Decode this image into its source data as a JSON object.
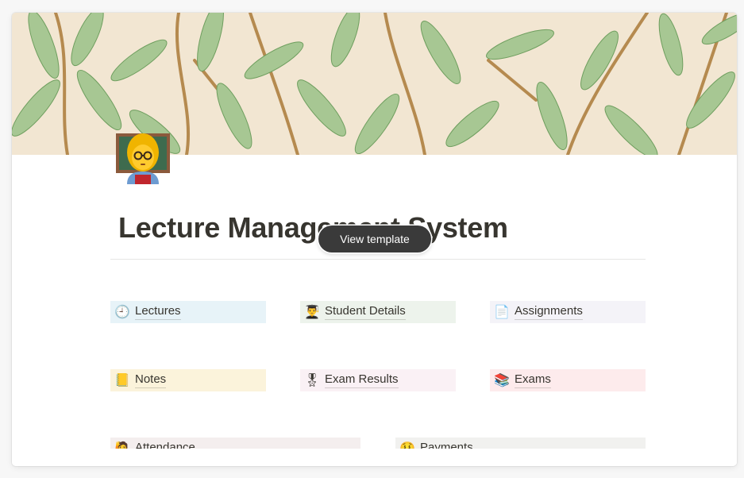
{
  "page": {
    "title": "Lecture Management System",
    "icon": "teacher-emoji-icon",
    "cover": "willow-leaf-pattern"
  },
  "overlay": {
    "view_template_label": "View template"
  },
  "links": [
    {
      "label": "Lectures",
      "icon": "clock-icon",
      "bg": "#e7f3f8"
    },
    {
      "label": "Student Details",
      "icon": "student-icon",
      "bg": "#edf3ec"
    },
    {
      "label": "Assignments",
      "icon": "document-icon",
      "bg": "#f4f3f8"
    },
    {
      "label": "Notes",
      "icon": "notebook-icon",
      "bg": "#fbf3db"
    },
    {
      "label": "Exam Results",
      "icon": "medal-icon",
      "bg": "#faf1f5"
    },
    {
      "label": "Exams",
      "icon": "books-icon",
      "bg": "#fdebec"
    },
    {
      "label": "Attendance",
      "icon": "raising-hand-icon",
      "bg": "#f4eeee"
    },
    {
      "label": "Payments",
      "icon": "money-face-icon",
      "bg": "#f1f1ef"
    }
  ]
}
